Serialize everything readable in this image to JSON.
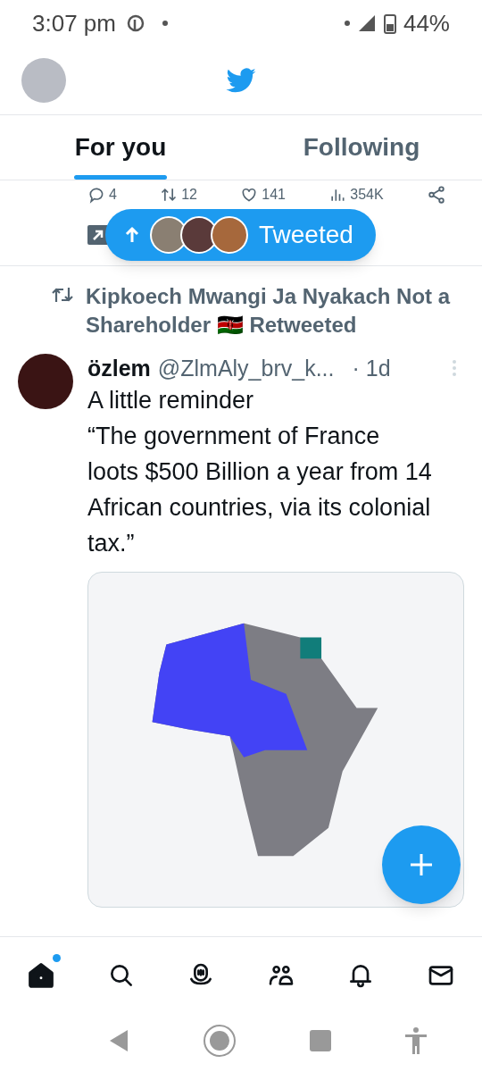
{
  "status_bar": {
    "time": "3:07 pm",
    "battery": "44%"
  },
  "tabs": [
    {
      "label": "For you",
      "selected": true
    },
    {
      "label": "Following",
      "selected": false
    }
  ],
  "previous_tweet_stats": {
    "replies": "4",
    "retweets": "12",
    "likes": "141",
    "views": "354K"
  },
  "new_tweets_pill": {
    "label": "Tweeted"
  },
  "tweet": {
    "retweeted_by": "Kipkoech Mwangi Ja Nyakach Not a Shareholder 🇰🇪 Retweeted",
    "name": "özlem",
    "handle": "@ZlmAly_brv_k...",
    "time": "· 1d",
    "text": [
      "A little reminder",
      "“The government of France loots $500 Billion a year from 14 African countries, via its colonial tax.”"
    ]
  },
  "bottom_nav": [
    {
      "kind": "home",
      "selected": true,
      "badge": true
    },
    {
      "kind": "search",
      "selected": false,
      "badge": false
    },
    {
      "kind": "spaces",
      "selected": false,
      "badge": false
    },
    {
      "kind": "communities",
      "selected": false,
      "badge": false
    },
    {
      "kind": "notifications",
      "selected": false,
      "badge": false
    },
    {
      "kind": "messages",
      "selected": false,
      "badge": false
    }
  ]
}
